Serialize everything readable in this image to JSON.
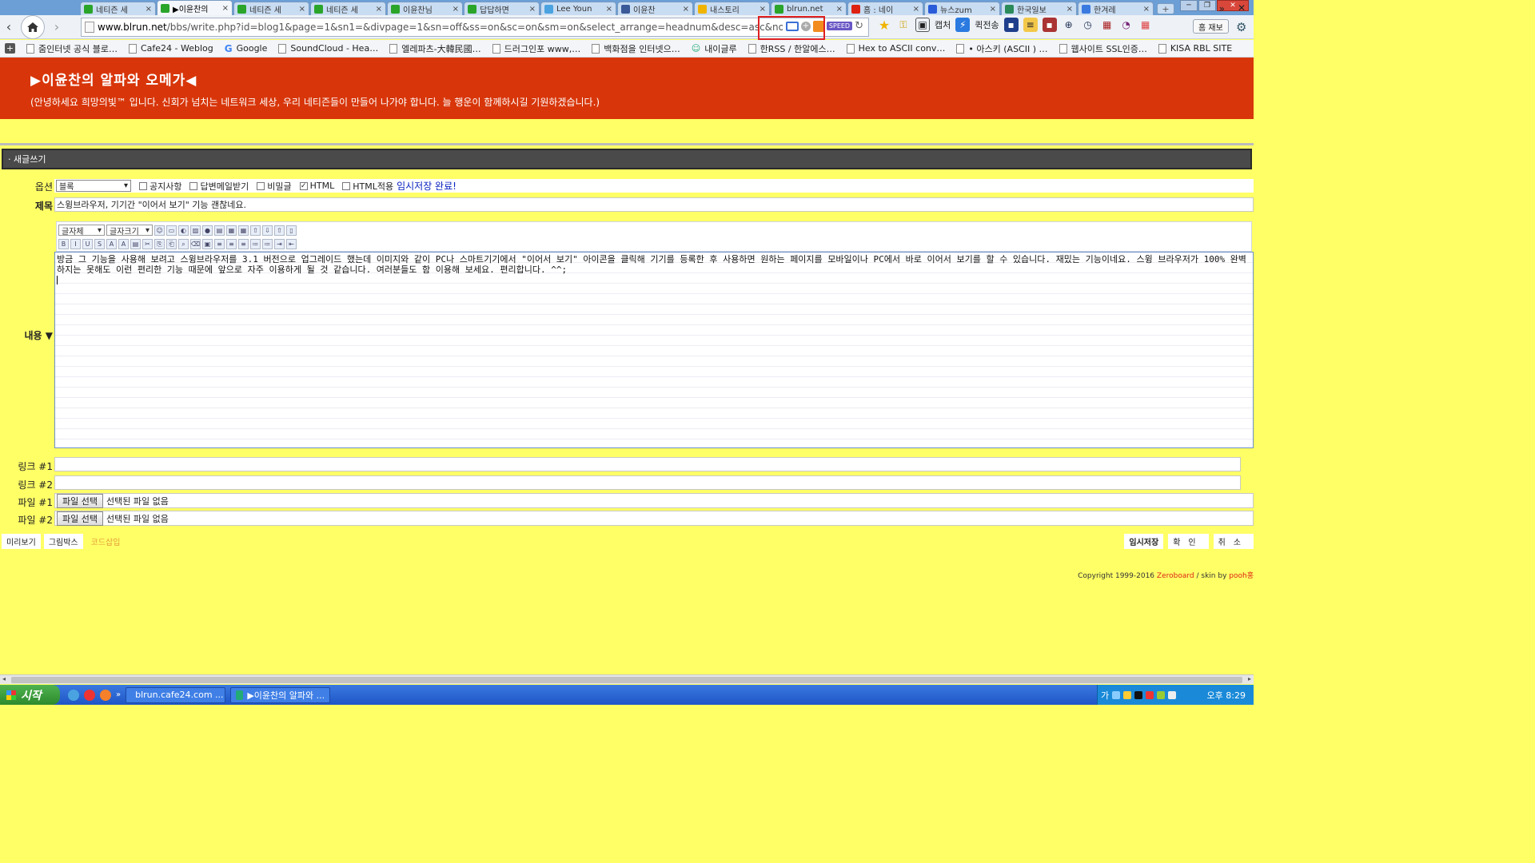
{
  "browser": {
    "tabs": [
      {
        "title": "네티즌 세",
        "color": "#2aa52a",
        "active": false
      },
      {
        "title": "▶이윤찬의",
        "color": "#2aa52a",
        "active": true
      },
      {
        "title": "네티즌 세",
        "color": "#2aa52a",
        "active": false
      },
      {
        "title": "네티즌 세",
        "color": "#2aa52a",
        "active": false
      },
      {
        "title": "이윤찬님",
        "color": "#2aa52a",
        "active": false
      },
      {
        "title": "답답하면",
        "color": "#2aa52a",
        "active": false
      },
      {
        "title": "Lee Youn",
        "color": "#4aa3e0",
        "active": false
      },
      {
        "title": "이윤찬",
        "color": "#3b5998",
        "active": false
      },
      {
        "title": "내스토리",
        "color": "#f0b400",
        "active": false
      },
      {
        "title": "blrun.net",
        "color": "#2aa52a",
        "active": false
      },
      {
        "title": "홈 : 네이",
        "color": "#d21",
        "active": false
      },
      {
        "title": "뉴스zum",
        "color": "#2a5bd8",
        "active": false
      },
      {
        "title": "한국일보",
        "color": "#2a8a5a",
        "active": false
      },
      {
        "title": "한겨레",
        "color": "#3a7ae0",
        "active": false
      }
    ],
    "address": {
      "host": "www.blrun.net",
      "path": "/bbs/write.php?id=blog1&page=1&sn1=&divpage=1&sn=off&ss=on&sc=on&sm=on&select_arrange=headnum&desc=asc&no=&mode=w"
    },
    "toolbar": {
      "capture_label": "캡처",
      "quicksend_label": "퀵전송",
      "hold_label": "홈 재보",
      "speed_label": "SPEED"
    },
    "bookmarks": [
      {
        "label": "줌인터넷 공식 블로…",
        "icon": "page"
      },
      {
        "label": "Cafe24 - Weblog",
        "icon": "page"
      },
      {
        "label": "Google",
        "icon": "g"
      },
      {
        "label": "SoundCloud - Hea…",
        "icon": "page"
      },
      {
        "label": "엘레파츠-大韓民國…",
        "icon": "page"
      },
      {
        "label": "드러그인포 www,…",
        "icon": "page"
      },
      {
        "label": "백화점을 인터넷으…",
        "icon": "page"
      },
      {
        "label": "내이글루",
        "icon": "person"
      },
      {
        "label": "한RSS / 한알에스…",
        "icon": "page"
      },
      {
        "label": "Hex to ASCII conv…",
        "icon": "page"
      },
      {
        "label": "• 아스키 (ASCII ) …",
        "icon": "page"
      },
      {
        "label": "웹사이트 SSL인증…",
        "icon": "page"
      },
      {
        "label": "KISA RBL SITE",
        "icon": "page"
      }
    ]
  },
  "page": {
    "site_title": "▶이윤찬의 알파와 오메가◀",
    "site_subtitle": "(안녕하세요 희망의빛™ 입니다. 신회가 넘치는 네트워크 세상, 우리 네티즌들이 만들어 나가야 합니다. 늘 행운이 함께하시길 기원하겠습니다.)",
    "section_label": "· 새글쓰기"
  },
  "form": {
    "option_label": "옵션",
    "option_select_value": "블록",
    "checkboxes": [
      {
        "label": "공지사항",
        "checked": false
      },
      {
        "label": "답변메일받기",
        "checked": false
      },
      {
        "label": "비밀글",
        "checked": false
      },
      {
        "label": "HTML",
        "checked": true
      },
      {
        "label": "HTML적용",
        "checked": false
      }
    ],
    "temp_saved_text": "임시저장 완료!",
    "subject_label": "제목",
    "subject_value": "스윙브라우저, 기기간 \"이어서 보기\" 기능 괜찮네요.",
    "content_label": "내용 ▼",
    "font_select": "글자체",
    "size_select": "글자크기",
    "content_text": "방금 그 기능을 사용해 보려고 스윙브라우저를 3.1 버전으로 업그레이드 했는데 이미지와 같이 PC나 스마트기기에서 \"이어서 보기\" 아이콘을 클릭해 기기를 등록한 후 사용하면 원하는 페이지를 모바일이나 PC에서 바로 이어서 보기를 할 수 있습니다. 재밌는 기능이네요. 스윙 브라우저가 100% 완벽하지는 못해도 이런 편리한 기능 때문에 앞으로 자주 이용하게 될 것 같습니다. 여러분들도 함 이용해 보세요. 편리합니다. ^^;",
    "link1_label": "링크 #1",
    "link1_value": "",
    "link2_label": "링크 #2",
    "link2_value": "",
    "file1_label": "파일 #1",
    "file2_label": "파일 #2",
    "file_button": "파일 선택",
    "file_status": "선택된 파일 없음",
    "preview_label": "미리보기",
    "imagebox_label": "그림박스",
    "code_insert_label": "코드삽입",
    "temp_save_button": "임시저장",
    "confirm_button": "확인",
    "cancel_button": "취소"
  },
  "footer": {
    "copyright_prefix": "Copyright 1999-2016",
    "zeroboard": "Zeroboard",
    "skin_text": "/ skin by",
    "skin_author": "pooh홍"
  },
  "taskbar": {
    "start_label": "시작",
    "tasks": [
      {
        "label": "blrun.cafe24.com ...",
        "color": "#d23"
      },
      {
        "label": "▶이윤찬의 알파와 ...",
        "color": "#2a7"
      }
    ],
    "ime": "가",
    "clock": "오후 8:29"
  }
}
